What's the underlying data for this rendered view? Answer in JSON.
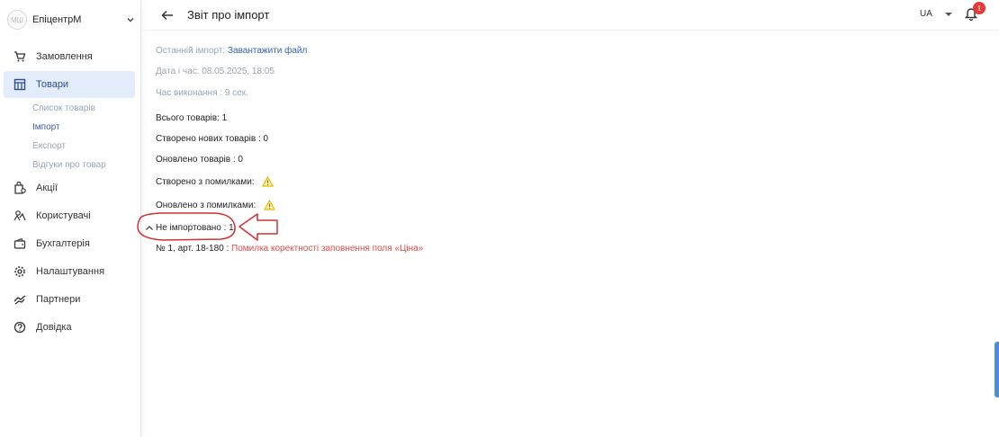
{
  "sidebar": {
    "avatar_text": "МШ",
    "store_name": "ЕпіцентрМ",
    "items": [
      {
        "label": "Замовлення"
      },
      {
        "label": "Товари"
      },
      {
        "label": "Акції"
      },
      {
        "label": "Користувачі"
      },
      {
        "label": "Бухгалтерія"
      },
      {
        "label": "Налаштування"
      },
      {
        "label": "Партнери"
      },
      {
        "label": "Довідка"
      }
    ],
    "sub_items": [
      {
        "label": "Список товарів"
      },
      {
        "label": "Імпорт"
      },
      {
        "label": "Експорт"
      },
      {
        "label": "Відгуки про товар"
      }
    ]
  },
  "header": {
    "title": "Звіт про імпорт",
    "language": "UA",
    "notification_count": "1"
  },
  "report": {
    "last_import_label": "Останній імпорт:",
    "download_link": "Завантажити файл",
    "datetime": "Дата і час: 08.05.2025, 18:05",
    "duration": "Час виконання : 9 сек.",
    "total": "Всього товарів: 1",
    "created": "Створено нових товарів : 0",
    "updated": "Оновлено товарів : 0",
    "created_errors": "Створено з помилками:",
    "updated_errors": "Оновлено з помилками:",
    "not_imported": "Не імпортовано : 1",
    "error_item_prefix": "№ 1, арт. 18-180 :",
    "error_item_message": "Помилка коректності заповнення поля «Ціна»"
  },
  "colors": {
    "accent": "#2f64b3",
    "error": "#e24b4b",
    "warning": "#f5c518",
    "annotation": "#d32f2f"
  }
}
